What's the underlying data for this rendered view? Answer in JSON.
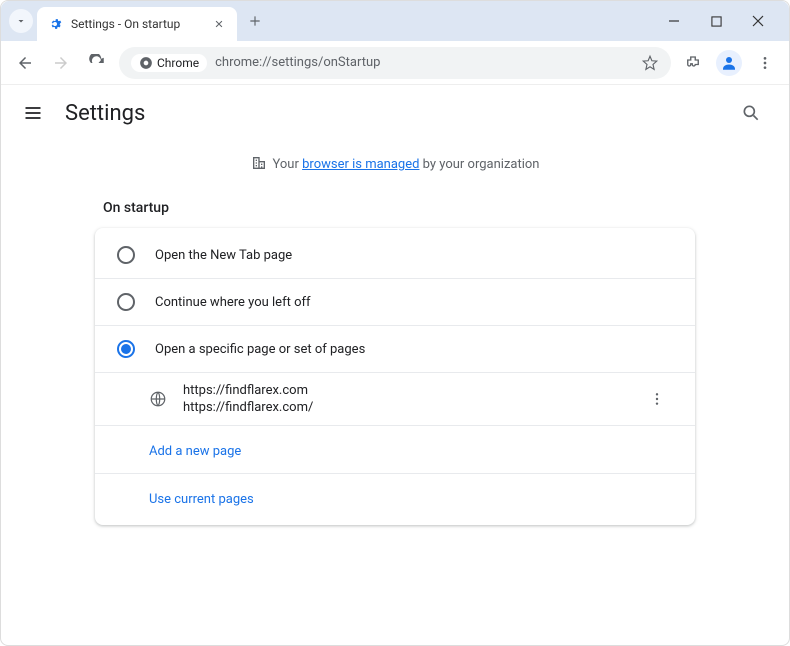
{
  "tab": {
    "title": "Settings - On startup"
  },
  "omnibox": {
    "chip": "Chrome",
    "url": "chrome://settings/onStartup"
  },
  "header": {
    "title": "Settings"
  },
  "managed": {
    "prefix": "Your ",
    "link": "browser is managed",
    "suffix": " by your organization"
  },
  "section": {
    "title": "On startup"
  },
  "options": {
    "new_tab": "Open the New Tab page",
    "continue": "Continue where you left off",
    "specific": "Open a specific page or set of pages"
  },
  "page_entry": {
    "title": "https://findflarex.com",
    "url": "https://findflarex.com/"
  },
  "actions": {
    "add_page": "Add a new page",
    "use_current": "Use current pages"
  }
}
